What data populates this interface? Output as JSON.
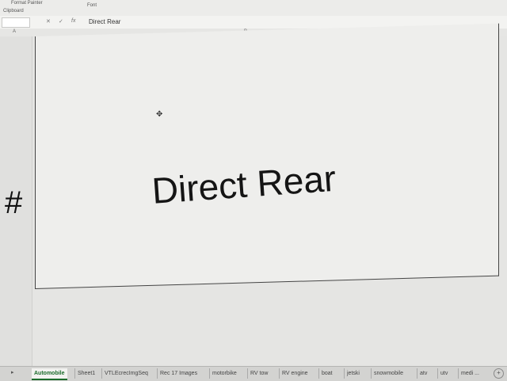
{
  "ribbon": {
    "clipboard_label": "Clipboard",
    "format_painter_label": "Format Painter",
    "font_label": "Font"
  },
  "formula_bar": {
    "value": "Direct Rear"
  },
  "columns": [
    "A",
    "B"
  ],
  "cell": {
    "value": "Direct Rear",
    "adjacent_value": "#"
  },
  "sheets": [
    "Automobile",
    "Sheet1",
    "VTLEcrecImgSeq",
    "Rec 17 Images",
    "motorbike",
    "RV tow",
    "RV engine",
    "boat",
    "jetski",
    "snowmobile",
    "atv",
    "utv",
    "medi ..."
  ],
  "active_sheet": "Automobile"
}
